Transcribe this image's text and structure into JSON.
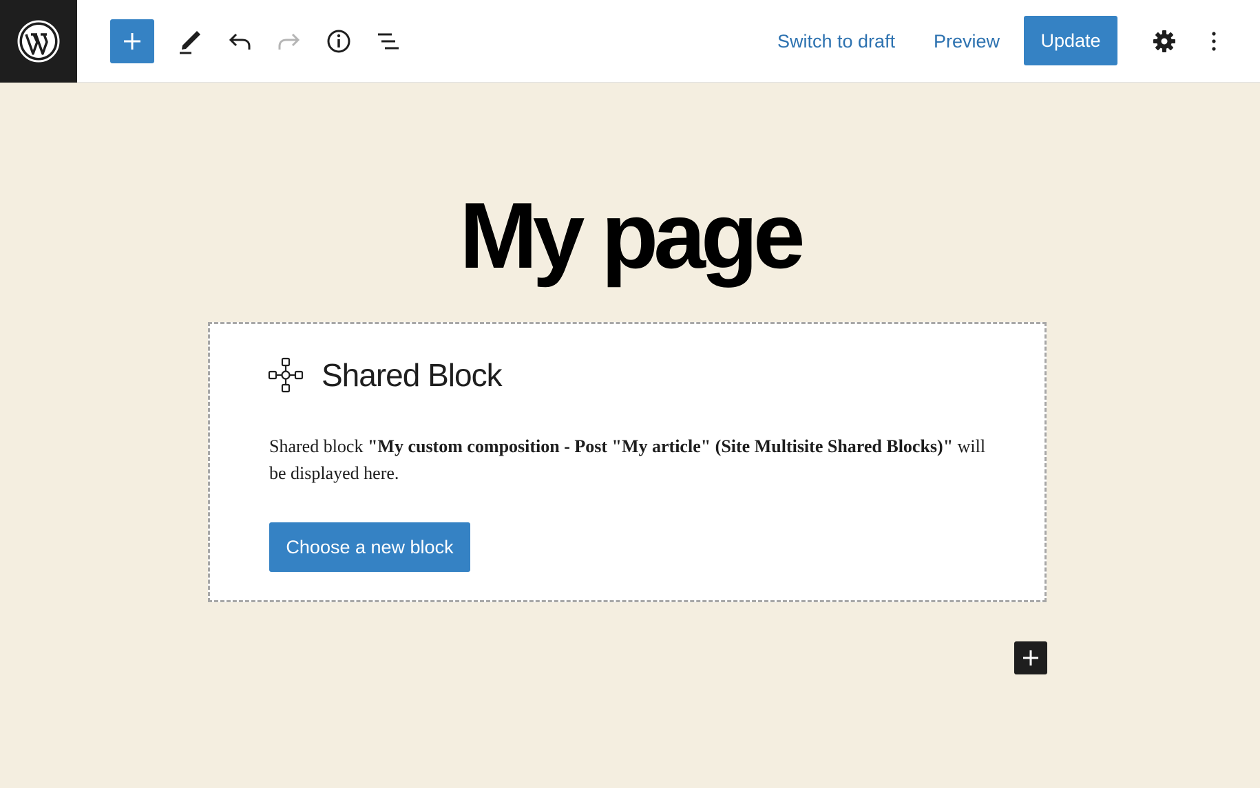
{
  "toolbar": {
    "logo_icon": "wordpress-logo-icon",
    "inserter_icon": "plus-icon",
    "edit_icon": "pencil-icon",
    "undo_icon": "undo-icon",
    "redo_icon": "redo-icon",
    "info_icon": "info-icon",
    "outline_icon": "list-view-icon",
    "switch_to_draft": "Switch to draft",
    "preview": "Preview",
    "update": "Update",
    "settings_icon": "gear-icon",
    "more_icon": "vertical-ellipsis-icon"
  },
  "editor": {
    "title": "My page",
    "shared_block": {
      "icon": "shared-block-icon",
      "label": "Shared Block",
      "text_before": "Shared block ",
      "text_bold": "\"My custom composition - Post \"My article\" (Site Multisite Shared Blocks)\"",
      "text_after": " will be displayed here.",
      "button": "Choose a new block"
    },
    "add_block_icon": "plus-icon"
  },
  "colors": {
    "accent": "#3582c4",
    "canvas": "#f4eee0",
    "logo_bg": "#1e1e1e"
  }
}
